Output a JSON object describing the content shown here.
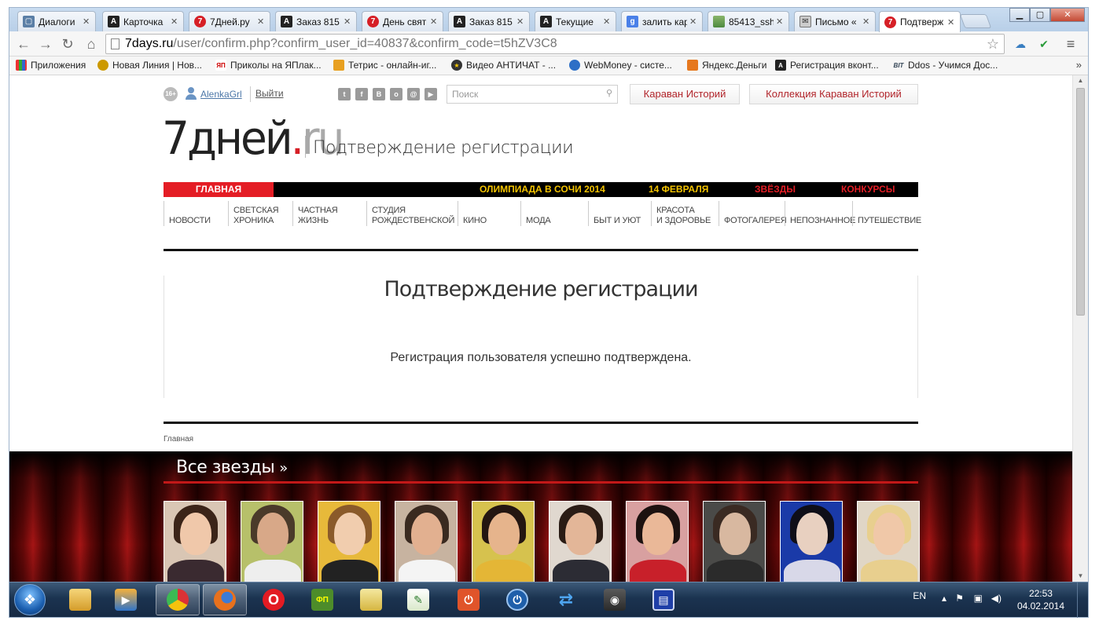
{
  "browser": {
    "tabs": [
      {
        "label": "Диалоги",
        "icon": "vk-icon"
      },
      {
        "label": "Карточка",
        "icon": "a-icon"
      },
      {
        "label": "7Дней.ру",
        "icon": "7days-icon"
      },
      {
        "label": "Заказ 815",
        "icon": "a-icon"
      },
      {
        "label": "День свят",
        "icon": "7days-icon"
      },
      {
        "label": "Заказ 815",
        "icon": "a-icon"
      },
      {
        "label": "Текущие",
        "icon": "a-icon"
      },
      {
        "label": "залить кар",
        "icon": "google-icon"
      },
      {
        "label": "85413_ssh",
        "icon": "image-icon"
      },
      {
        "label": "Письмо «",
        "icon": "mail-icon"
      },
      {
        "label": "Подтверж",
        "icon": "7days-icon",
        "active": true
      }
    ],
    "url_host": "7days.ru",
    "url_rest": "/user/confirm.php?confirm_user_id=40837&confirm_code=t5hZV3C8",
    "bookmarks": [
      {
        "label": "Приложения",
        "icon": "apps-icon"
      },
      {
        "label": "Новая Линия | Нов...",
        "icon": "globe-icon"
      },
      {
        "label": "Приколы на ЯПлак...",
        "icon": "yap-icon"
      },
      {
        "label": "Тетрис - онлайн-иг...",
        "icon": "tetris-icon"
      },
      {
        "label": "Видео АНТИЧАТ - ...",
        "icon": "star-icon"
      },
      {
        "label": "WebMoney - систе...",
        "icon": "webmoney-icon"
      },
      {
        "label": "Яндекс.Деньги",
        "icon": "yandex-money-icon"
      },
      {
        "label": "Регистрация вконт...",
        "icon": "a-icon"
      },
      {
        "label": "Ddos - Учимся Дос...",
        "icon": "bit-icon"
      }
    ],
    "bookmarks_more": "»"
  },
  "site": {
    "age": "16+",
    "username": "AlenkaGrl",
    "logout": "Выйти",
    "social": [
      "twitter-icon",
      "facebook-icon",
      "vk-icon",
      "odnoklassniki-icon",
      "mail-ru-icon",
      "youtube-icon"
    ],
    "search_placeholder": "Поиск",
    "btn_caravan": "Караван Историй",
    "btn_collection": "Коллекция Караван Историй",
    "logo_main": "7дней",
    "logo_dot": ".",
    "logo_ru": "ru",
    "header_title": "Подтверждение регистрации",
    "nav_primary": {
      "home": "ГЛАВНАЯ",
      "olympics": "ОЛИМПИАДА В СОЧИ 2014",
      "feb14": "14 ФЕВРАЛЯ",
      "stars": "ЗВЁЗДЫ",
      "contests": "КОНКУРСЫ"
    },
    "nav_primary_colors": {
      "olympics": "#f5c400",
      "feb14": "#f5c400",
      "stars": "#e41d25",
      "contests": "#e41d25"
    },
    "nav_secondary": [
      {
        "line1": "",
        "line2": "НОВОСТИ"
      },
      {
        "line1": "СВЕТСКАЯ",
        "line2": "ХРОНИКА"
      },
      {
        "line1": "ЧАСТНАЯ",
        "line2": "ЖИЗНЬ"
      },
      {
        "line1": "СТУДИЯ",
        "line2": "РОЖДЕСТВЕНСКОЙ"
      },
      {
        "line1": "",
        "line2": "КИНО"
      },
      {
        "line1": "",
        "line2": "МОДА"
      },
      {
        "line1": "",
        "line2": "БЫТ И УЮТ"
      },
      {
        "line1": "КРАСОТА",
        "line2": "И ЗДОРОВЬЕ"
      },
      {
        "line1": "",
        "line2": "ФОТОГАЛЕРЕЯ"
      },
      {
        "line1": "",
        "line2": "НЕПОЗНАННОЕ"
      },
      {
        "line1": "",
        "line2": "ПУТЕШЕСТВИЕ"
      }
    ],
    "content_title": "Подтверждение регистрации",
    "content_message": "Регистрация пользователя успешно подтверждена.",
    "breadcrumb": "Главная",
    "stars_title": "Все звезды",
    "stars_chevron": "»"
  },
  "taskbar": {
    "apps": [
      "explorer-icon",
      "media-player-icon",
      "chrome-icon",
      "firefox-icon",
      "opera-icon",
      "game-icon",
      "image-viewer-icon",
      "notepad-icon",
      "power-icon",
      "power-manager-icon",
      "sync-icon",
      "steam-icon",
      "floppy-icon"
    ],
    "lang": "EN",
    "time": "22:53",
    "date": "04.02.2014"
  }
}
